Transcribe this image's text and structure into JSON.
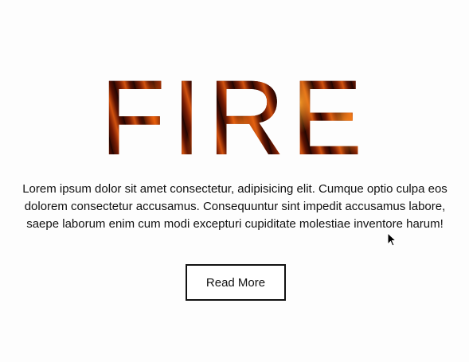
{
  "hero": {
    "title": "FIRE",
    "body": "Lorem ipsum dolor sit amet consectetur, adipisicing elit. Cumque optio culpa eos dolorem consectetur accusamus. Consequuntur sint impedit accusamus labore, saepe laborum enim cum modi excepturi cupiditate molestiae inventore harum!",
    "button_label": "Read More"
  },
  "colors": {
    "background": "#fdfdfd",
    "text": "#111111",
    "fire_dark": "#3a0b02",
    "fire_mid": "#d2520e",
    "fire_bright": "#ff8c14"
  },
  "icons": {
    "cursor": "mouse-pointer-icon"
  }
}
